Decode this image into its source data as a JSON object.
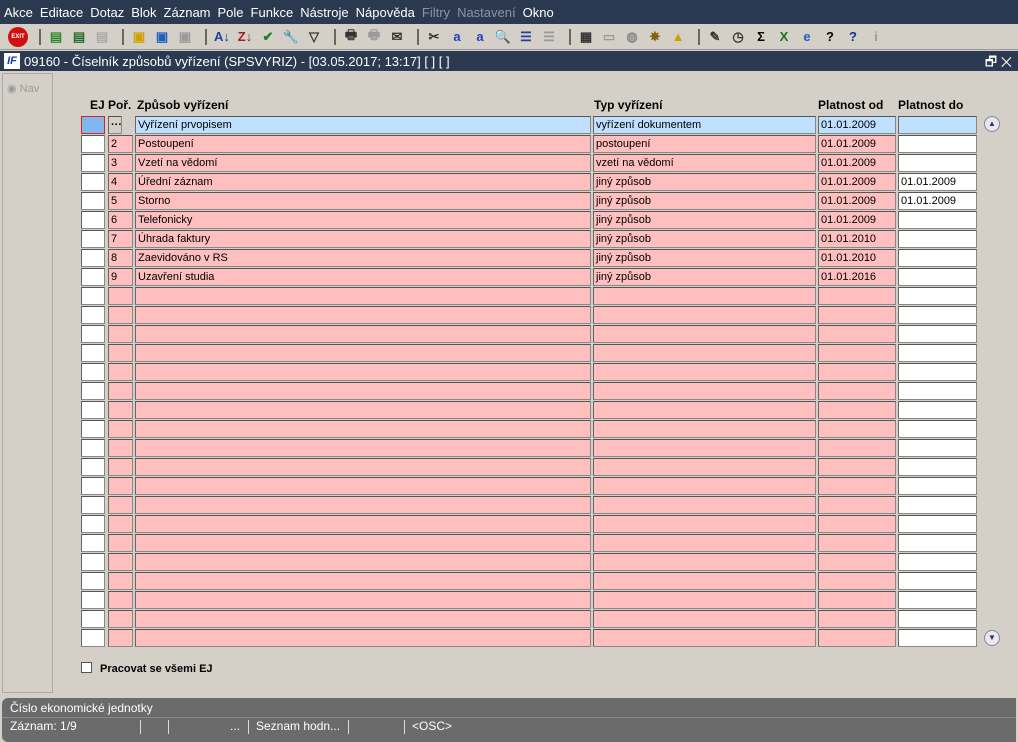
{
  "menu": [
    {
      "label": "Akce"
    },
    {
      "label": "Editace"
    },
    {
      "label": "Dotaz"
    },
    {
      "label": "Blok"
    },
    {
      "label": "Záznam"
    },
    {
      "label": "Pole"
    },
    {
      "label": "Funkce"
    },
    {
      "label": "Nástroje"
    },
    {
      "label": "Nápověda"
    },
    {
      "label": "Filtry",
      "disabled": true
    },
    {
      "label": "Nastavení",
      "disabled": true
    },
    {
      "label": "Okno"
    }
  ],
  "toolbar": {
    "exit": "EXIT",
    "sum": "Σ",
    "help": "?"
  },
  "window": {
    "title": "09160 - Číselník způsobů vyřízení (SPSVYRIZ) - [03.05.2017; 13:17]  [ ]  [ ]",
    "logo": "IF"
  },
  "nav_label": "Nav",
  "columns": {
    "ej": "EJ",
    "por": "Poř.",
    "zpusob": "Způsob vyřízení",
    "typ": "Typ vyřízení",
    "od": "Platnost od",
    "do": "Platnost do"
  },
  "rows": [
    {
      "por": "···",
      "zpusob": "Vyřízení prvopisem",
      "typ": "vyřízení dokumentem",
      "od": "01.01.2009",
      "do": ""
    },
    {
      "por": "2",
      "zpusob": "Postoupení",
      "typ": "postoupení",
      "od": "01.01.2009",
      "do": ""
    },
    {
      "por": "3",
      "zpusob": "Vzetí na vědomí",
      "typ": "vzetí na vědomí",
      "od": "01.01.2009",
      "do": ""
    },
    {
      "por": "4",
      "zpusob": "Úřední záznam",
      "typ": "jiný způsob",
      "od": "01.01.2009",
      "do": "01.01.2009"
    },
    {
      "por": "5",
      "zpusob": "Storno",
      "typ": "jiný způsob",
      "od": "01.01.2009",
      "do": "01.01.2009"
    },
    {
      "por": "6",
      "zpusob": "Telefonicky",
      "typ": "jiný způsob",
      "od": "01.01.2009",
      "do": ""
    },
    {
      "por": "7",
      "zpusob": "Úhrada faktury",
      "typ": "jiný způsob",
      "od": "01.01.2010",
      "do": ""
    },
    {
      "por": "8",
      "zpusob": "Zaevidováno v RS",
      "typ": "jiný způsob",
      "od": "01.01.2010",
      "do": ""
    },
    {
      "por": "9",
      "zpusob": "Uzavření studia",
      "typ": "jiný způsob",
      "od": "01.01.2016",
      "do": ""
    }
  ],
  "total_rows": 28,
  "checkbox_label": "Pracovat se všemi EJ",
  "status": {
    "hint": "Číslo ekonomické jednotky",
    "record": "Záznam: 1/9",
    "dots": "...",
    "list": "Seznam hodn...",
    "osc": "<OSC>"
  }
}
